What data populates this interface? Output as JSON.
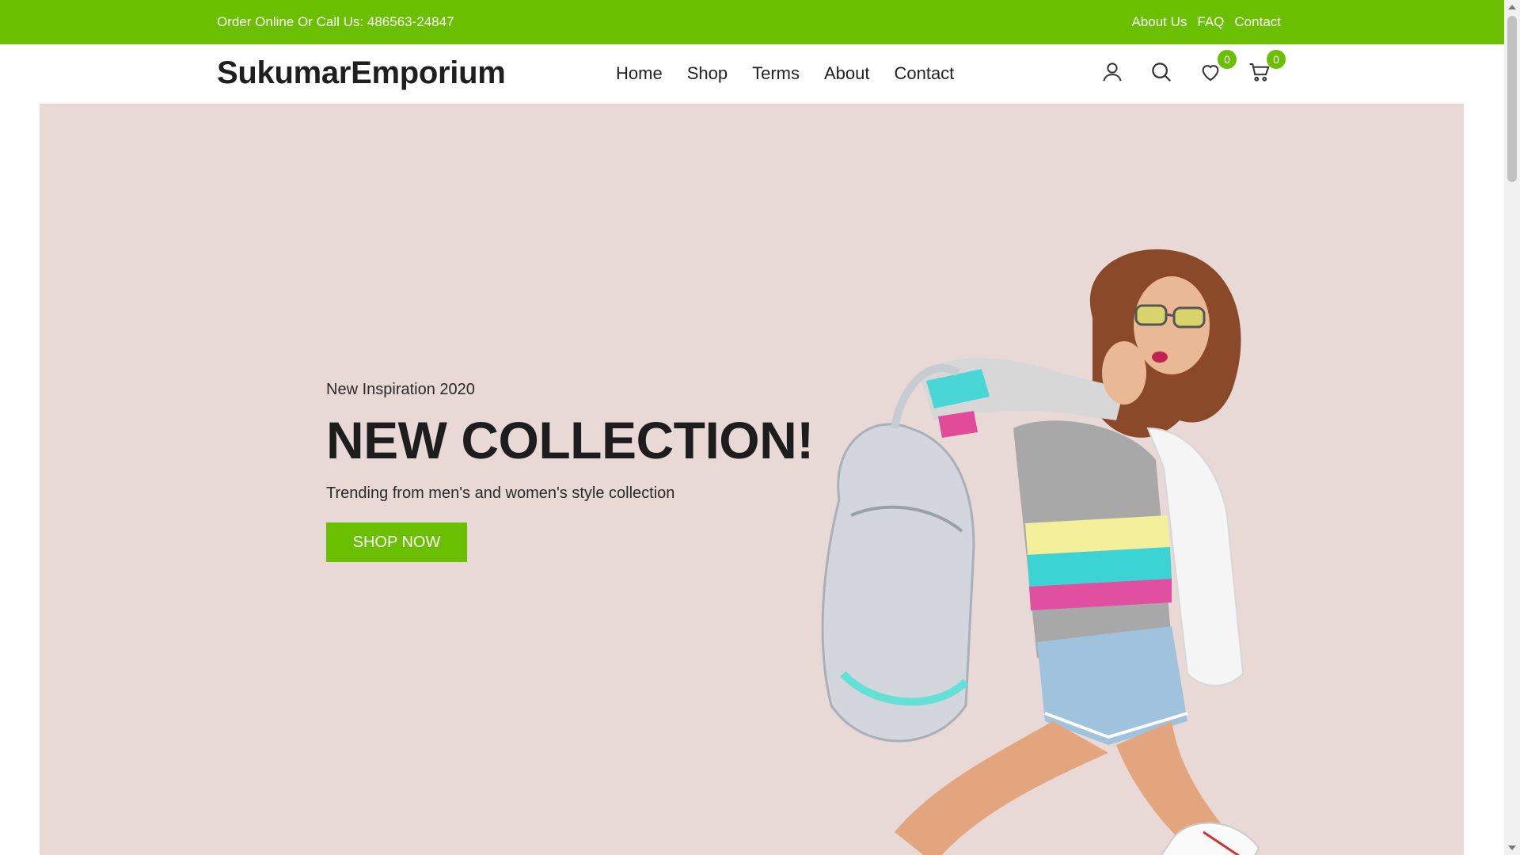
{
  "topbar": {
    "phone_text": "Order Online Or Call Us: 486563-24847",
    "links": [
      "About Us",
      "FAQ",
      "Contact"
    ]
  },
  "header": {
    "logo": "SukumarEmporium",
    "nav": [
      "Home",
      "Shop",
      "Terms",
      "About",
      "Contact"
    ],
    "wishlist_count": "0",
    "cart_count": "0",
    "icons": [
      "user-icon",
      "search-icon",
      "heart-icon",
      "cart-icon"
    ]
  },
  "hero": {
    "subhead": "New Inspiration 2020",
    "headline": "NEW COLLECTION!",
    "tagline": "Trending from men's and women's style collection",
    "button_label": "SHOP NOW"
  },
  "colors": {
    "accent": "#6abf00",
    "hero_bg": "#e8d8d6"
  }
}
